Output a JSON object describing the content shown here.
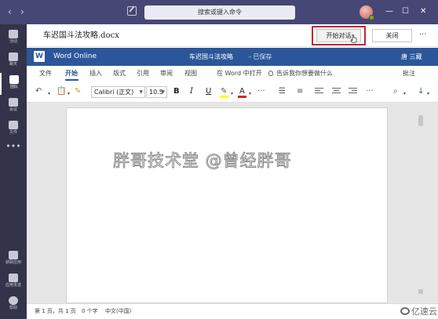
{
  "teams": {
    "search_placeholder": "搜索或键入命令",
    "rail": [
      {
        "label": "活动",
        "icon": "bell-icon"
      },
      {
        "label": "聊天",
        "icon": "chat-icon"
      },
      {
        "label": "团队",
        "icon": "teams-icon"
      },
      {
        "label": "会议",
        "icon": "calendar-icon"
      },
      {
        "label": "文件",
        "icon": "files-icon"
      },
      {
        "label": "获取应用",
        "icon": "store-icon"
      },
      {
        "label": "应用发送",
        "icon": "apps-icon"
      },
      {
        "label": "帮助",
        "icon": "help-icon"
      }
    ],
    "more_label": "•••"
  },
  "document": {
    "filename": "车迟国斗法攻略.docx",
    "start_conversation_label": "开始对话",
    "close_label": "关闭",
    "more_label": "···"
  },
  "word": {
    "app_name": "Word Online",
    "doc_title": "车迟国斗法攻略",
    "saved_status": "- 已保存",
    "user_name": "唐 三藏"
  },
  "ribbon": {
    "tabs": [
      "文件",
      "开始",
      "插入",
      "版式",
      "引用",
      "审阅",
      "视图"
    ],
    "active_tab": "开始",
    "open_in_word": "在 Word 中打开",
    "tell_me": "告诉我你想要做什么",
    "comment_label": "批注"
  },
  "toolbar": {
    "font_name": "Calibri (正文)",
    "font_size": "10.5",
    "bold": "B",
    "italic": "I",
    "underline": "U",
    "highlight_color": "#ffff00",
    "font_color": "#e02020"
  },
  "canvas": {
    "watermark": "胖哥技术堂 @曾经胖哥"
  },
  "status": {
    "page": "第 1 页，共 1 页",
    "words": "0 个字",
    "language": "中文(中国)"
  },
  "brand": {
    "logo_text": "亿速云"
  },
  "colors": {
    "teams_purple": "#464775",
    "word_blue": "#2b579a",
    "highlight_box": "#c4262e"
  }
}
